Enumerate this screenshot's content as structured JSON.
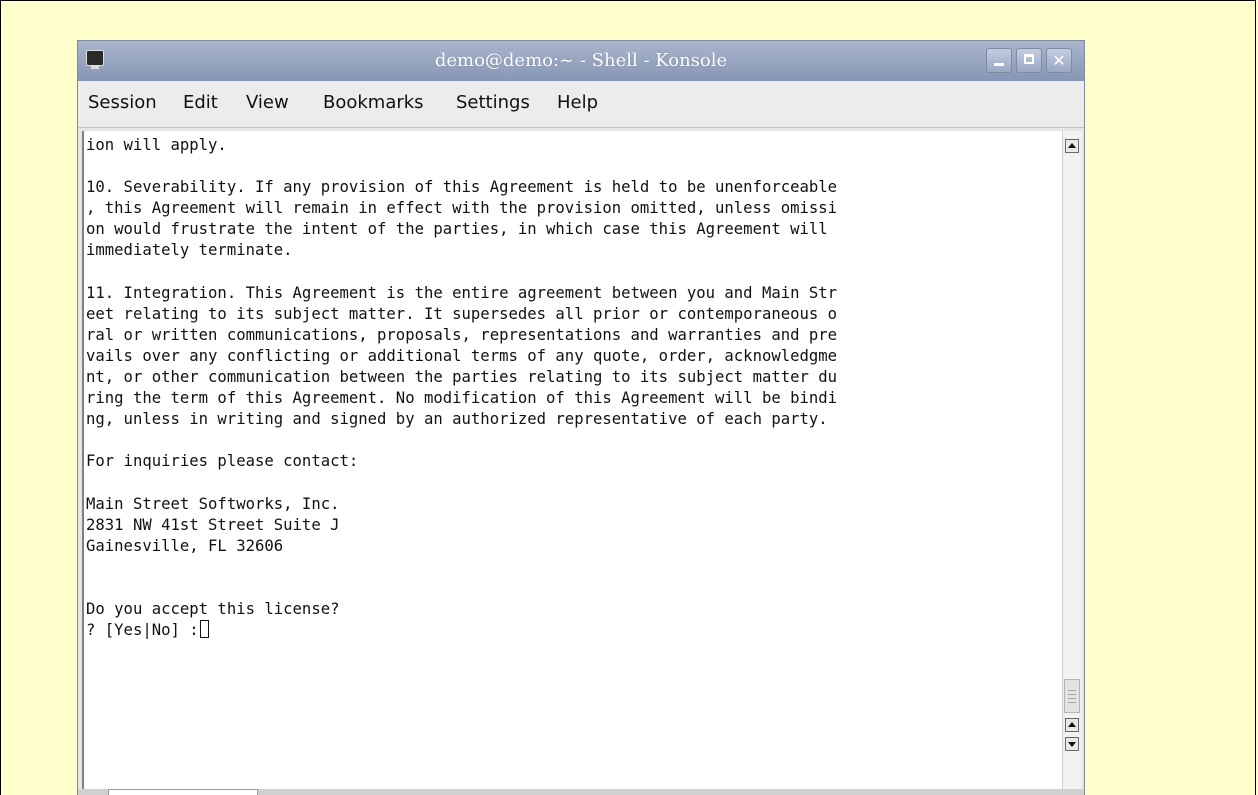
{
  "window": {
    "title": "demo@demo:~ - Shell - Konsole"
  },
  "menubar": {
    "items": [
      {
        "label": "Session"
      },
      {
        "label": "Edit"
      },
      {
        "label": "View"
      },
      {
        "label": "Bookmarks"
      },
      {
        "label": "Settings"
      },
      {
        "label": "Help"
      }
    ]
  },
  "terminal": {
    "lines": [
      "ion will apply.",
      "",
      "10. Severability. If any provision of this Agreement is held to be unenforceable",
      ", this Agreement will remain in effect with the provision omitted, unless omissi",
      "on would frustrate the intent of the parties, in which case this Agreement will",
      "immediately terminate.",
      "",
      "11. Integration. This Agreement is the entire agreement between you and Main Str",
      "eet relating to its subject matter. It supersedes all prior or contemporaneous o",
      "ral or written communications, proposals, representations and warranties and pre",
      "vails over any conflicting or additional terms of any quote, order, acknowledgme",
      "nt, or other communication between the parties relating to its subject matter du",
      "ring the term of this Agreement. No modification of this Agreement will be bindi",
      "ng, unless in writing and signed by an authorized representative of each party.",
      "",
      "For inquiries please contact:",
      "",
      "Main Street Softworks, Inc.",
      "2831 NW 41st Street Suite J",
      "Gainesville, FL 32606",
      "",
      "",
      "Do you accept this license?"
    ],
    "prompt": "? [Yes|No] :"
  },
  "colors": {
    "page_background": "#ffffcc",
    "titlebar": "#8796b4",
    "terminal_background": "#ffffff",
    "menubar": "#ececec"
  },
  "icons": {
    "app": "konsole-terminal-icon",
    "minimize": "minimize-icon",
    "maximize": "maximize-icon",
    "close": "close-icon",
    "scroll_up": "scroll-up-arrow-icon",
    "scroll_down": "scroll-down-arrow-icon"
  }
}
